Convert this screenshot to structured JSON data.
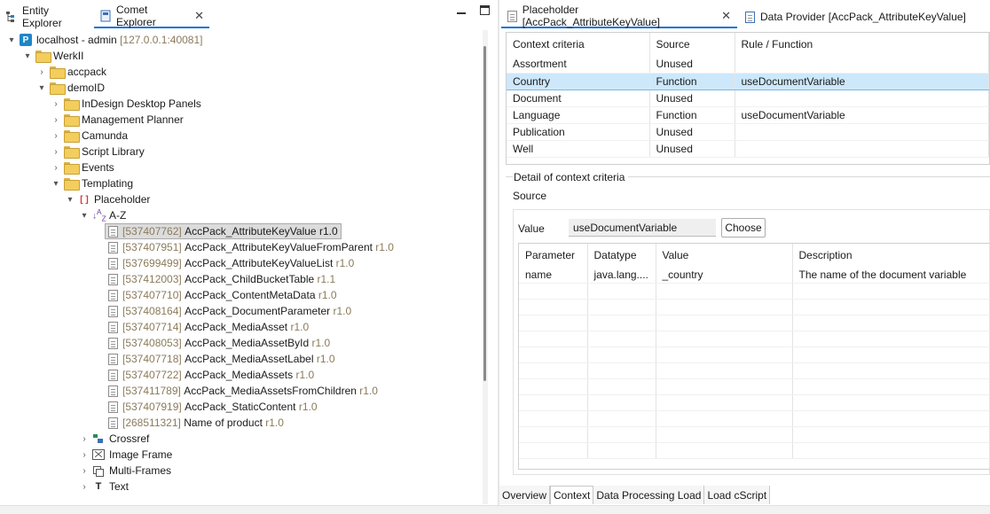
{
  "left_tabs": [
    {
      "label": "Entity Explorer",
      "icon": "entity-explorer-icon"
    },
    {
      "label": "Comet Explorer",
      "icon": "comet-explorer-icon",
      "close": "✕"
    }
  ],
  "tree": {
    "server": {
      "label": "localhost - admin",
      "address": "[127.0.0.1:40081]"
    },
    "werkii": "WerkII",
    "accpack": "accpack",
    "demoid": "demoID",
    "demo_children": [
      "InDesign Desktop Panels",
      "Management Planner",
      "Camunda",
      "Script Library",
      "Events",
      "Templating"
    ],
    "placeholder": "Placeholder",
    "az": "A-Z",
    "az_letters": "A",
    "az_letters2": "Z",
    "items": [
      {
        "id": "[537407762]",
        "name": "AccPack_AttributeKeyValue",
        "rev": "r1.0"
      },
      {
        "id": "[537407951]",
        "name": "AccPack_AttributeKeyValueFromParent",
        "rev": "r1.0"
      },
      {
        "id": "[537699499]",
        "name": "AccPack_AttributeKeyValueList",
        "rev": "r1.0"
      },
      {
        "id": "[537412003]",
        "name": "AccPack_ChildBucketTable",
        "rev": "r1.1"
      },
      {
        "id": "[537407710]",
        "name": "AccPack_ContentMetaData",
        "rev": "r1.0"
      },
      {
        "id": "[537408164]",
        "name": "AccPack_DocumentParameter",
        "rev": "r1.0"
      },
      {
        "id": "[537407714]",
        "name": "AccPack_MediaAsset",
        "rev": "r1.0"
      },
      {
        "id": "[537408053]",
        "name": "AccPack_MediaAssetById",
        "rev": "r1.0"
      },
      {
        "id": "[537407718]",
        "name": "AccPack_MediaAssetLabel",
        "rev": "r1.0"
      },
      {
        "id": "[537407722]",
        "name": "AccPack_MediaAssets",
        "rev": "r1.0"
      },
      {
        "id": "[537411789]",
        "name": "AccPack_MediaAssetsFromChildren",
        "rev": "r1.0"
      },
      {
        "id": "[537407919]",
        "name": "AccPack_StaticContent",
        "rev": "r1.0"
      },
      {
        "id": "[268511321]",
        "name": "Name of product",
        "rev": "r1.0"
      }
    ],
    "templating_types": [
      "Crossref",
      "Image Frame",
      "Multi-Frames",
      "Text"
    ]
  },
  "right_tabs": [
    {
      "label": "Placeholder [AccPack_AttributeKeyValue]",
      "close": "✕"
    },
    {
      "label": "Data Provider [AccPack_AttributeKeyValue]"
    }
  ],
  "context_table": {
    "headers": [
      "Context criteria",
      "Source",
      "Rule / Function"
    ],
    "rows": [
      [
        "Assortment",
        "Unused",
        ""
      ],
      [
        "Country",
        "Function",
        "useDocumentVariable"
      ],
      [
        "Document",
        "Unused",
        ""
      ],
      [
        "Language",
        "Function",
        "useDocumentVariable"
      ],
      [
        "Publication",
        "Unused",
        ""
      ],
      [
        "Well",
        "Unused",
        ""
      ]
    ]
  },
  "detail": {
    "legend": "Detail of context criteria",
    "source_label": "Source",
    "value_label": "Value",
    "value": "useDocumentVariable",
    "choose_label": "Choose"
  },
  "param_table": {
    "headers": [
      "Parameter",
      "Datatype",
      "Value",
      "Description"
    ],
    "rows": [
      [
        "name",
        "java.lang....",
        "_country",
        "The name of the document variable"
      ]
    ]
  },
  "bottom_tabs": [
    "Overview",
    "Context",
    "Data Processing Load",
    "Load cScript"
  ],
  "colors": {
    "accent": "#1a73d9",
    "selection": "#cde8fb",
    "folder": "#f3cd5d",
    "server": "#1f86c8",
    "id_text": "#8a7a5a"
  }
}
